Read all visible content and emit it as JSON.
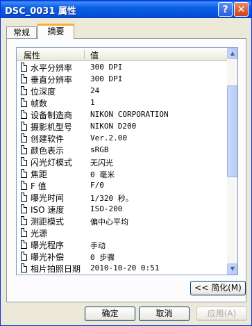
{
  "window": {
    "title": "DSC_0031 属性",
    "help_label": "?",
    "close_label": "✕"
  },
  "tabs": [
    {
      "label": "常规",
      "active": false
    },
    {
      "label": "摘要",
      "active": true
    }
  ],
  "list": {
    "headers": {
      "name": "属性",
      "value": "值"
    },
    "rows": [
      {
        "name": "水平分辨率",
        "value": "300 DPI"
      },
      {
        "name": "垂直分辨率",
        "value": "300 DPI"
      },
      {
        "name": "位深度",
        "value": "24"
      },
      {
        "name": "帧数",
        "value": "1"
      },
      {
        "name": "设备制造商",
        "value": "NIKON CORPORATION"
      },
      {
        "name": "摄影机型号",
        "value": "NIKON D200"
      },
      {
        "name": "创建软件",
        "value": "Ver.2.00"
      },
      {
        "name": "颜色表示",
        "value": "sRGB"
      },
      {
        "name": "闪光灯模式",
        "value": "无闪光"
      },
      {
        "name": "焦距",
        "value": "0 毫米"
      },
      {
        "name": "F 值",
        "value": "F/0"
      },
      {
        "name": "曝光时间",
        "value": "1/320 秒。"
      },
      {
        "name": "ISO 速度",
        "value": "ISO-200"
      },
      {
        "name": "测距模式",
        "value": "偏中心平均"
      },
      {
        "name": "光源",
        "value": ""
      },
      {
        "name": "曝光程序",
        "value": "手动"
      },
      {
        "name": "曝光补偿",
        "value": "0 步骤"
      },
      {
        "name": "相片拍照日期",
        "value": "2010-10-20 0:51"
      }
    ]
  },
  "buttons": {
    "simplify": "<< 简化(M)",
    "ok": "确定",
    "cancel": "取消",
    "apply": "应用(A)"
  }
}
